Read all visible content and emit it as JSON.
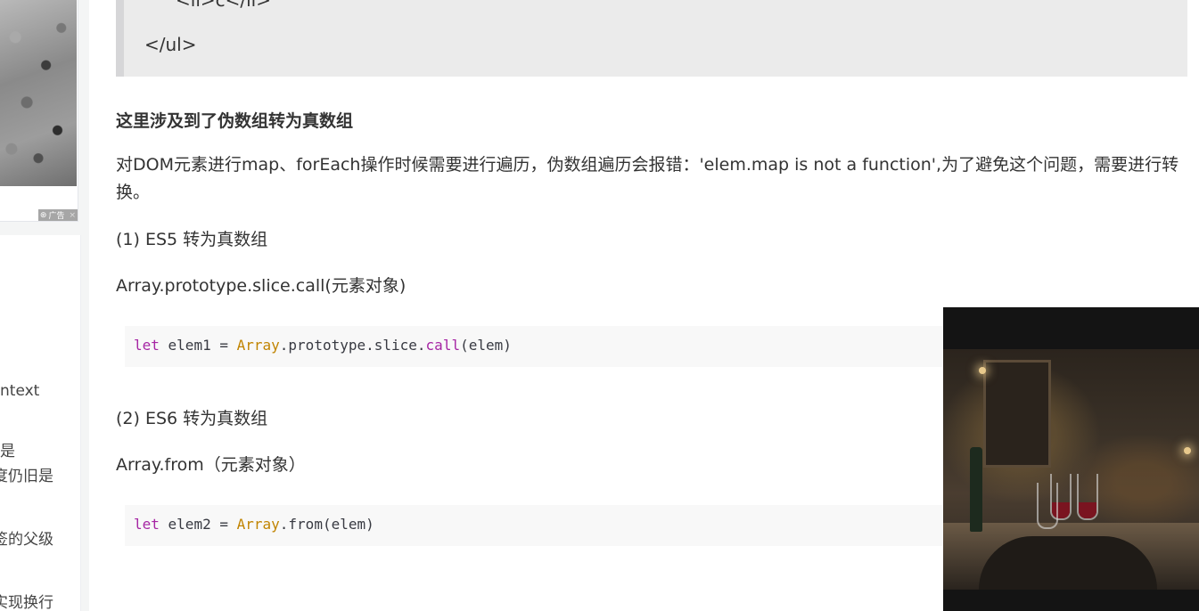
{
  "sidebar": {
    "ad": {
      "badge_label": "广告",
      "close_glyph": "×",
      "badge_icon": "ad-logo-icon"
    },
    "toc_items": [
      {
        "label": "ntext"
      },
      {
        "label": "是"
      },
      {
        "label": "度仍旧是"
      },
      {
        "label": "签的父级"
      },
      {
        "label": "实现换行"
      }
    ]
  },
  "article": {
    "quote_lines": [
      "<li>c</li>",
      "</ul>"
    ],
    "heading": "这里涉及到了伪数组转为真数组",
    "intro": "对DOM元素进行map、forEach操作时候需要进行遍历，伪数组遍历会报错：'elem.map is not a function',为了避免这个问题，需要进行转换。",
    "es5_title": "(1) ES5 转为真数组",
    "es5_method": "Array.prototype.slice.call(元素对象)",
    "es5_code": {
      "kw": "let",
      "var": " elem1 = ",
      "cls": "Array",
      "mid": ".prototype.slice.",
      "fn": "call",
      "end": "(elem)"
    },
    "es6_title": "(2) ES6 转为真数组",
    "es6_method": "Array.from（元素对象）",
    "es6_code": {
      "kw": "let",
      "var": " elem2 = ",
      "cls": "Array",
      "end": ".from(elem)"
    }
  }
}
